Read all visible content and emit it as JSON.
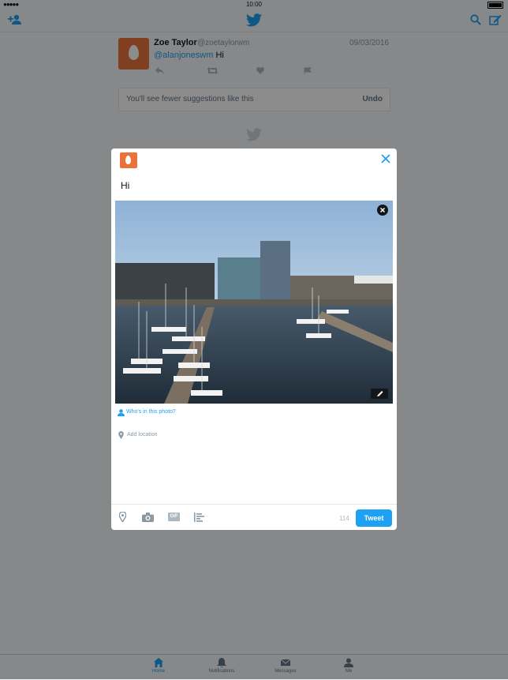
{
  "statusbar": {
    "time": "10:00",
    "signal": "●●●●●"
  },
  "navbar": {
    "add_user_icon": "add-user-icon",
    "logo_icon": "twitter-bird-icon",
    "search_icon": "search-icon",
    "compose_icon": "compose-icon"
  },
  "timeline_tweet": {
    "name": "Zoe Taylor",
    "handle": "@zoetaylorwm",
    "date": "09/03/2016",
    "mention": "@alanjoneswm",
    "text": "Hi"
  },
  "suggestion": {
    "message": "You'll see fewer suggestions like this",
    "undo_label": "Undo"
  },
  "compose": {
    "text": "Hi",
    "tag_people_label": "Who's in this photo?",
    "location_label": "Add location",
    "char_count": "114",
    "gif_label": "GIF",
    "tweet_button": "Tweet"
  },
  "tabs": [
    {
      "label": "Home",
      "icon": "home-icon",
      "active": true
    },
    {
      "label": "Notifications",
      "icon": "bell-icon",
      "active": false
    },
    {
      "label": "Messages",
      "icon": "envelope-icon",
      "active": false
    },
    {
      "label": "Me",
      "icon": "person-icon",
      "active": false
    }
  ],
  "colors": {
    "accent": "#1da1f2",
    "avatar": "#e9733b",
    "dim_overlay": "rgba(0,0,0,0.45)"
  }
}
